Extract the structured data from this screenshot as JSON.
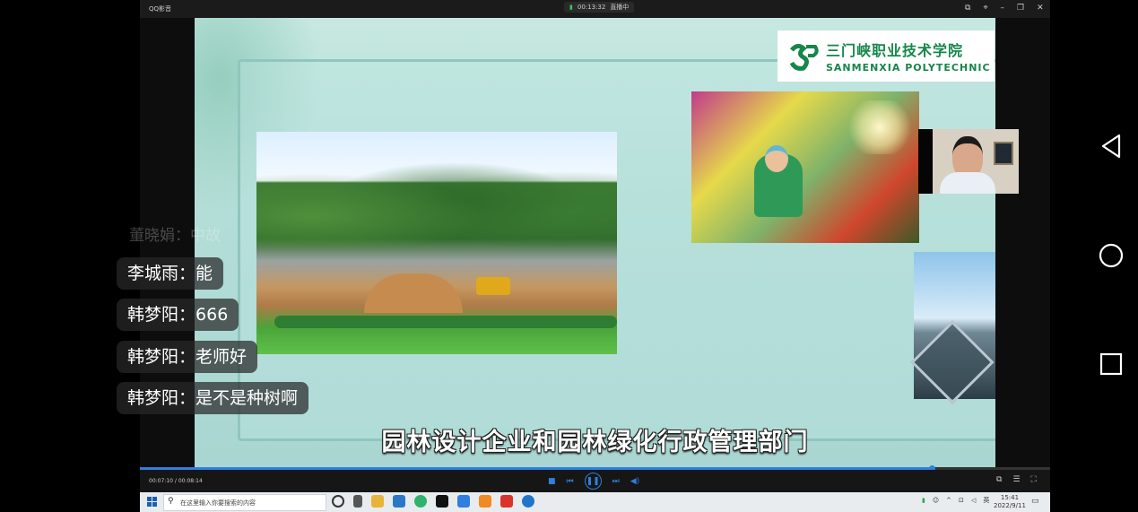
{
  "player": {
    "app_name": "QQ影音",
    "live_time": "00:13:32",
    "live_status": "直播中",
    "current_time": "00:07:10",
    "duration": "00:08:14",
    "progress_fraction": 0.87
  },
  "slide": {
    "logo_cn": "三门峡职业技术学院",
    "logo_en": "SANMENXIA POLYTECHNIC",
    "subtitle": "园林设计企业和园林绿化行政管理部门"
  },
  "chat": {
    "faded_text": "董晓娟：中故",
    "messages": [
      {
        "user": "李城雨",
        "sep": "：",
        "text": "能"
      },
      {
        "user": "韩梦阳",
        "sep": "：",
        "text": "666"
      },
      {
        "user": "韩梦阳",
        "sep": "：",
        "text": "老师好"
      },
      {
        "user": "韩梦阳",
        "sep": "：",
        "text": "是不是种树啊"
      }
    ]
  },
  "taskbar": {
    "search_placeholder": "在这里输入你要搜索的内容",
    "input_lang": "英",
    "time": "15:41",
    "date": "2022/9/11"
  },
  "colors": {
    "accent": "#2f7fe0",
    "logo_green": "#16864a",
    "slide_bg": "#b3ddd7"
  },
  "icons": [
    "back-triangle-icon",
    "home-circle-icon",
    "recent-square-icon",
    "play-pause-icon",
    "search-icon",
    "windows-start-icon"
  ]
}
